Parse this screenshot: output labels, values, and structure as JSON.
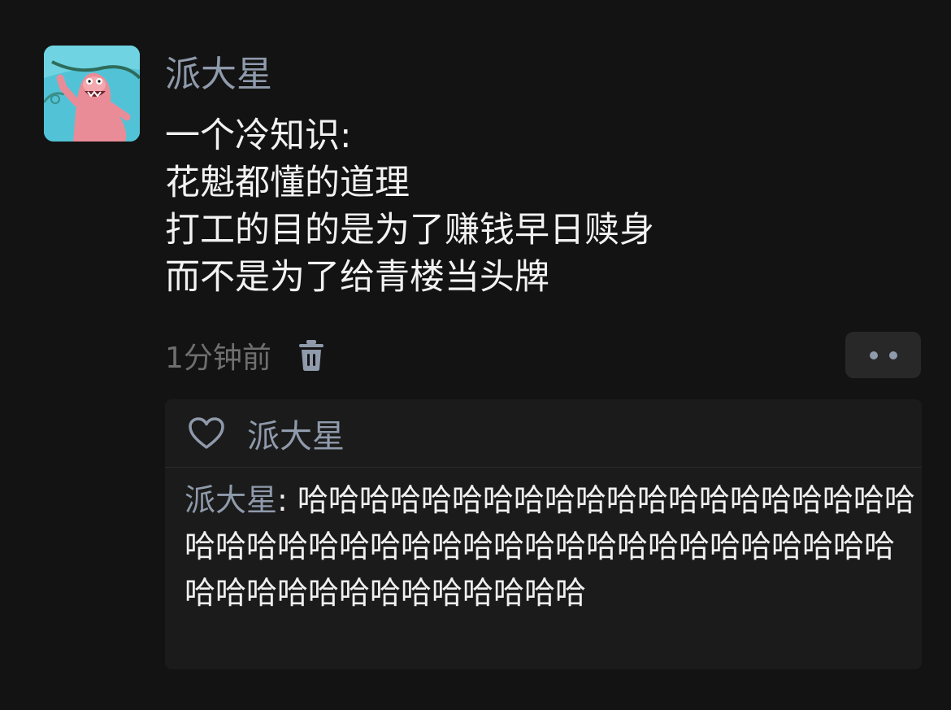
{
  "post": {
    "author": "派大星",
    "content_lines": [
      "一个冷知识:",
      "花魁都懂的道理",
      "打工的目的是为了赚钱早日赎身",
      "而不是为了给青楼当头牌"
    ],
    "timestamp": "1分钟前",
    "icons": {
      "delete": "trash-icon",
      "more": "more-dots-icon"
    }
  },
  "interactions": {
    "likes": {
      "icon": "heart-icon",
      "names": "派大星"
    },
    "comment": {
      "author": "派大星",
      "separator": ": ",
      "text": "哈哈哈哈哈哈哈哈哈哈哈哈哈哈哈哈哈哈哈哈哈哈哈哈哈哈哈哈哈哈哈哈哈哈哈哈哈哈哈哈哈哈哈哈哈哈哈哈哈哈哈哈哈哈哈哈"
    }
  },
  "colors": {
    "background": "#131313",
    "name_accent": "#8f9aab",
    "text": "#f2f2f2",
    "muted": "#6f6f6f",
    "panel": "#1b1b1b"
  }
}
